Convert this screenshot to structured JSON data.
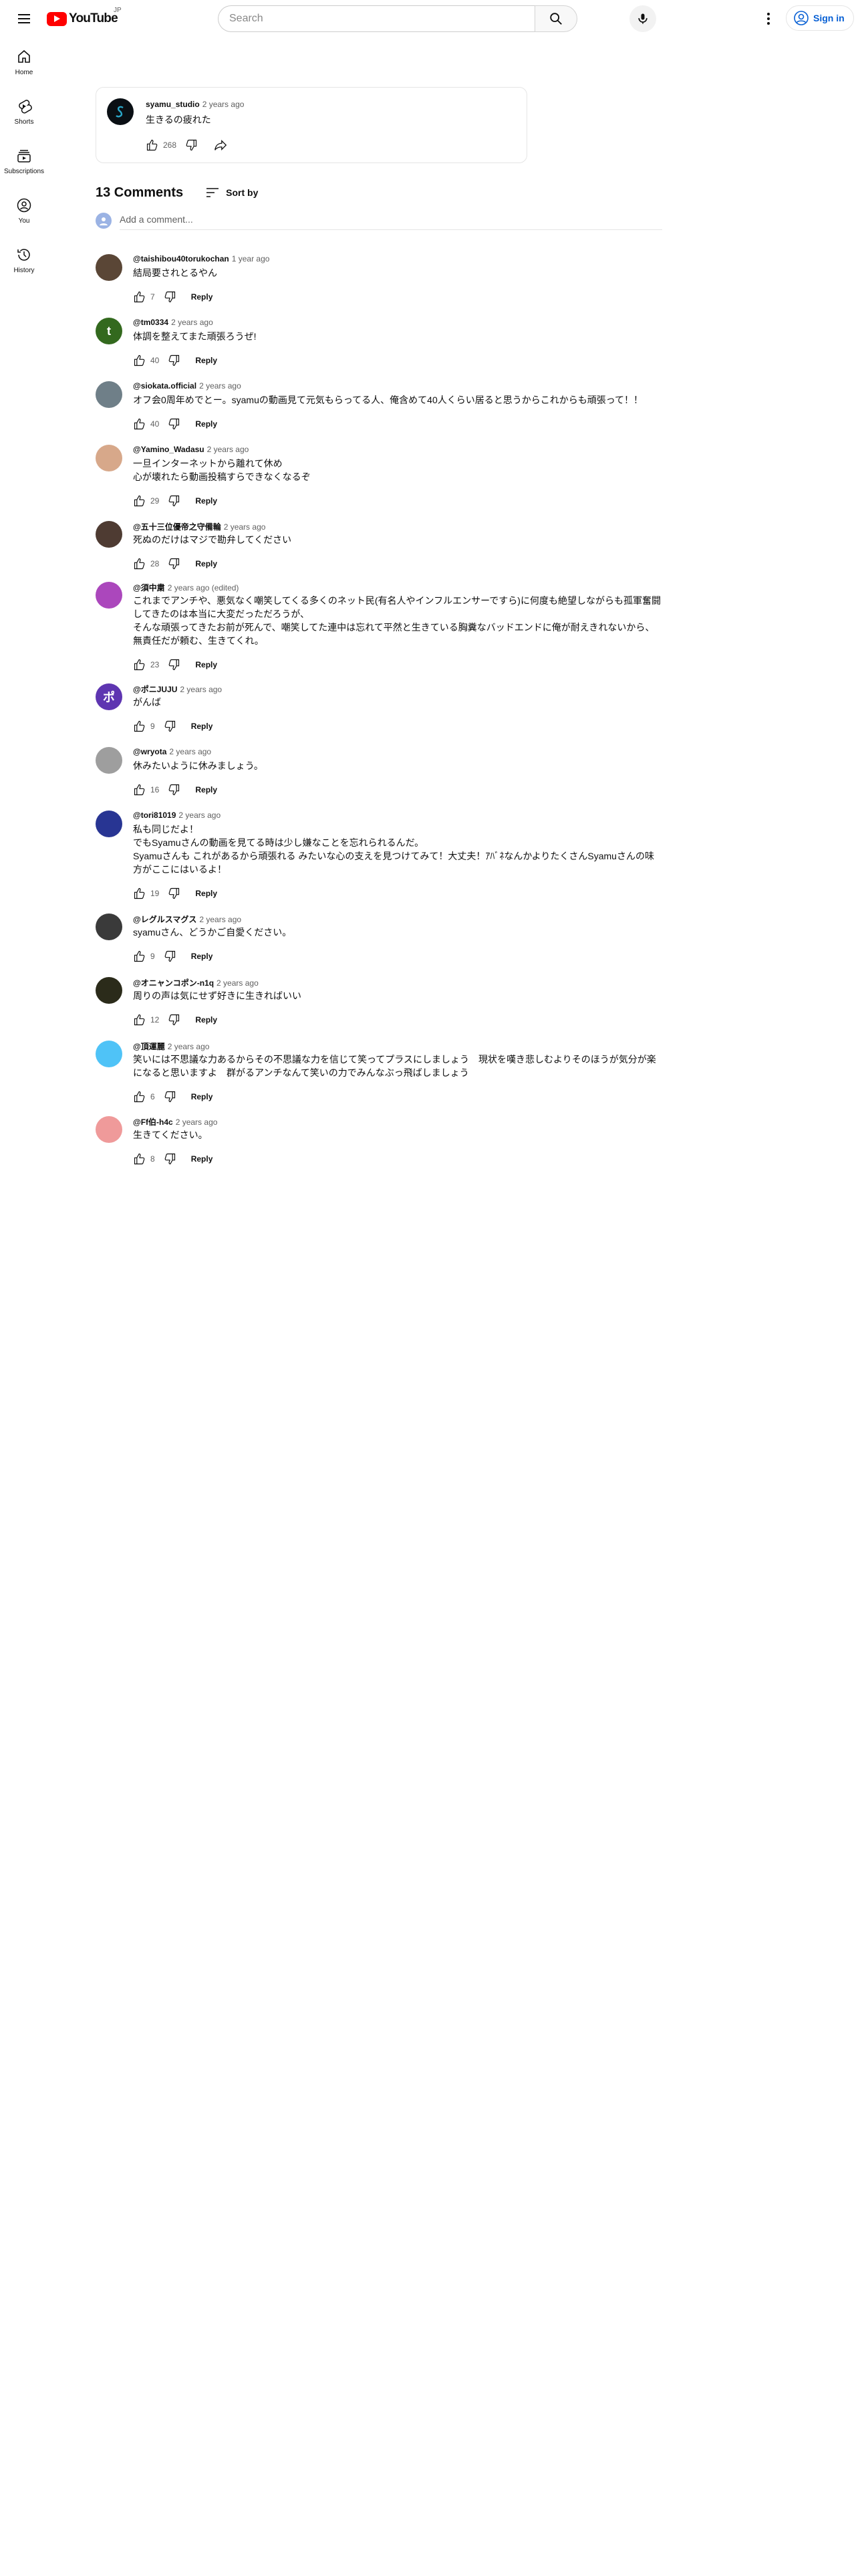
{
  "header": {
    "logo_text": "YouTube",
    "country_code": "JP",
    "search_placeholder": "Search",
    "signin_label": "Sign in"
  },
  "sidebar": {
    "items": [
      {
        "label": "Home",
        "icon": "home-icon"
      },
      {
        "label": "Shorts",
        "icon": "shorts-icon"
      },
      {
        "label": "Subscriptions",
        "icon": "subscriptions-icon"
      },
      {
        "label": "You",
        "icon": "you-icon"
      },
      {
        "label": "History",
        "icon": "history-icon"
      }
    ]
  },
  "post": {
    "author": "syamu_studio",
    "time": "2 years ago",
    "text": "生きるの疲れた",
    "likes": "268"
  },
  "comments_section": {
    "count_label": "13 Comments",
    "sort_label": "Sort by",
    "add_placeholder": "Add a comment...",
    "reply_label": "Reply"
  },
  "comments": [
    {
      "author": "@taishibou40torukochan",
      "time": "1 year ago",
      "text": "結局要されとるやん",
      "likes": "7",
      "avatar_color": "#5a4636",
      "avatar_glyph": ""
    },
    {
      "author": "@tm0334",
      "time": "2 years ago",
      "text": "体調を整えてまた頑張ろうぜ!",
      "likes": "40",
      "avatar_color": "#33691e",
      "avatar_glyph": "t"
    },
    {
      "author": "@siokata.official",
      "time": "2 years ago",
      "text": "オフ会0周年めでとー。syamuの動画見て元気もらってる人、俺含めて40人くらい居ると思うからこれからも頑張って！！",
      "likes": "40",
      "avatar_color": "#6f7f88",
      "avatar_glyph": ""
    },
    {
      "author": "@Yamino_Wadasu",
      "time": "2 years ago",
      "text": "一旦インターネットから離れて休め\n心が壊れたら動画投稿すらできなくなるぞ",
      "likes": "29",
      "avatar_color": "#d7a88a",
      "avatar_glyph": ""
    },
    {
      "author": "@五十三位優帝之守備輪",
      "time": "2 years ago",
      "text": "死ぬのだけはマジで勘弁してください",
      "likes": "28",
      "avatar_color": "#4e3b32",
      "avatar_glyph": ""
    },
    {
      "author": "@須中粛",
      "time": "2 years ago (edited)",
      "text": "これまでアンチや、悪気なく嘲笑してくる多くのネット民(有名人やインフルエンサーですら)に何度も絶望しながらも孤軍奮闘してきたのは本当に大変だっただろうが、\nそんな頑張ってきたお前が死んで、嘲笑してた連中は忘れて平然と生きている胸糞なバッドエンドに俺が耐えきれないから、無責任だが頼む、生きてくれ。",
      "likes": "23",
      "avatar_color": "#ab47bc",
      "avatar_glyph": ""
    },
    {
      "author": "@ポニJUJU",
      "time": "2 years ago",
      "text": "がんば",
      "likes": "9",
      "avatar_color": "#5e35b1",
      "avatar_glyph": "ポ"
    },
    {
      "author": "@wryota",
      "time": "2 years ago",
      "text": "休みたいように休みましょう。",
      "likes": "16",
      "avatar_color": "#9e9e9e",
      "avatar_glyph": ""
    },
    {
      "author": "@tori81019",
      "time": "2 years ago",
      "text": "私も同じだよ！\nでもSyamuさんの動画を見てる時は少し嫌なことを忘れられるんだ。\nSyamuさんも これがあるから頑張れる みたいな心の支えを見つけてみて！大丈夫！ｱﾊﾞﾈなんかよりたくさんSyamuさんの味方がここにはいるよ！",
      "likes": "19",
      "avatar_color": "#283593",
      "avatar_glyph": ""
    },
    {
      "author": "@レグルスマグス",
      "time": "2 years ago",
      "text": "syamuさん、どうかご自愛ください。",
      "likes": "9",
      "avatar_color": "#3a3a3a",
      "avatar_glyph": ""
    },
    {
      "author": "@オニャンコポン-n1q",
      "time": "2 years ago",
      "text": "周りの声は気にせず好きに生きればいい",
      "likes": "12",
      "avatar_color": "#2b2b1a",
      "avatar_glyph": ""
    },
    {
      "author": "@頂運麗",
      "time": "2 years ago",
      "text": "笑いには不思議な力あるからその不思議な力を信じて笑ってプラスにしましょう　現状を嘆き悲しむよりそのほうが気分が楽になると思いますよ　群がるアンチなんて笑いの力でみんなぶっ飛ばしましょう",
      "likes": "6",
      "avatar_color": "#4fc3f7",
      "avatar_glyph": ""
    },
    {
      "author": "@Ff伯-h4c",
      "time": "2 years ago",
      "text": "生きてください。",
      "likes": "8",
      "avatar_color": "#ef9a9a",
      "avatar_glyph": ""
    }
  ]
}
